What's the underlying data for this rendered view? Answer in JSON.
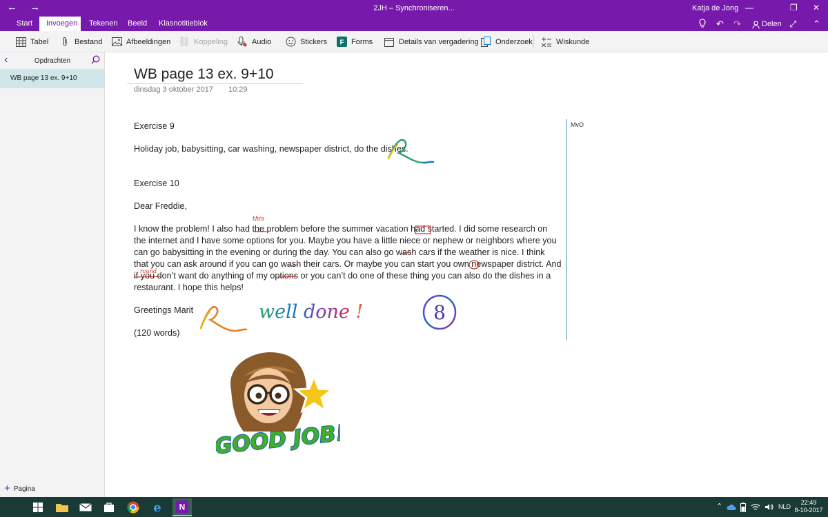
{
  "titlebar": {
    "app_title": "2JH – Synchroniseren...",
    "user": "Katja de Jong"
  },
  "tabs": [
    {
      "label": "Start"
    },
    {
      "label": "Invoegen"
    },
    {
      "label": "Tekenen"
    },
    {
      "label": "Beeld"
    },
    {
      "label": "Klasnotitieblok"
    }
  ],
  "share_label": "Delen",
  "ribbon": {
    "tabel": "Tabel",
    "bestand": "Bestand",
    "afbeeldingen": "Afbeeldingen",
    "koppeling": "Koppeling",
    "audio": "Audio",
    "stickers": "Stickers",
    "forms": "Forms",
    "details": "Details van vergadering",
    "onderzoek": "Onderzoek",
    "wiskunde": "Wiskunde"
  },
  "leftpane": {
    "section": "Opdrachten",
    "pages": [
      "WB page 13 ex. 9+10"
    ],
    "add_page": "Pagina"
  },
  "page": {
    "title": "WB page 13 ex. 9+10",
    "date": "dinsdag 3 oktober 2017",
    "time": "10:29",
    "exercise9_heading": "Exercise 9",
    "exercise9_text": "Holiday job, babysitting, car washing, newspaper district, do the dishes.",
    "exercise10_heading": "Exercise 10",
    "salutation": "Dear Freddie,",
    "letter": "I know the problem! I also had the problem before the summer vacation had started. I did some research on the internet and I have some options for you. Maybe you have a little niece or nephew or neighbors where you can go babysitting in the evening or during the day. You can also go wash cars if the weather is nice. I think that you can ask around if you can go wash their cars. Or maybe you can start you own newspaper district. And if you don’t want do anything of my options or you can’t do one of these thing you can also do the dishes in a restaurant. I hope this helps!",
    "closing": "Greetings Marit",
    "word_count": "(120 words)",
    "initials": "MvO"
  },
  "ink": {
    "well_done": "well done !",
    "grade": "8",
    "note_this": "this",
    "note_round": "round"
  },
  "sticker": {
    "text": "GOOD JOB!"
  },
  "taskbar": {
    "language": "NLD",
    "time": "22:49",
    "date": "8-10-2017"
  },
  "colors": {
    "accent": "#7719aa",
    "page_selected": "#cfe7e9",
    "taskbar": "#1a3a35"
  }
}
